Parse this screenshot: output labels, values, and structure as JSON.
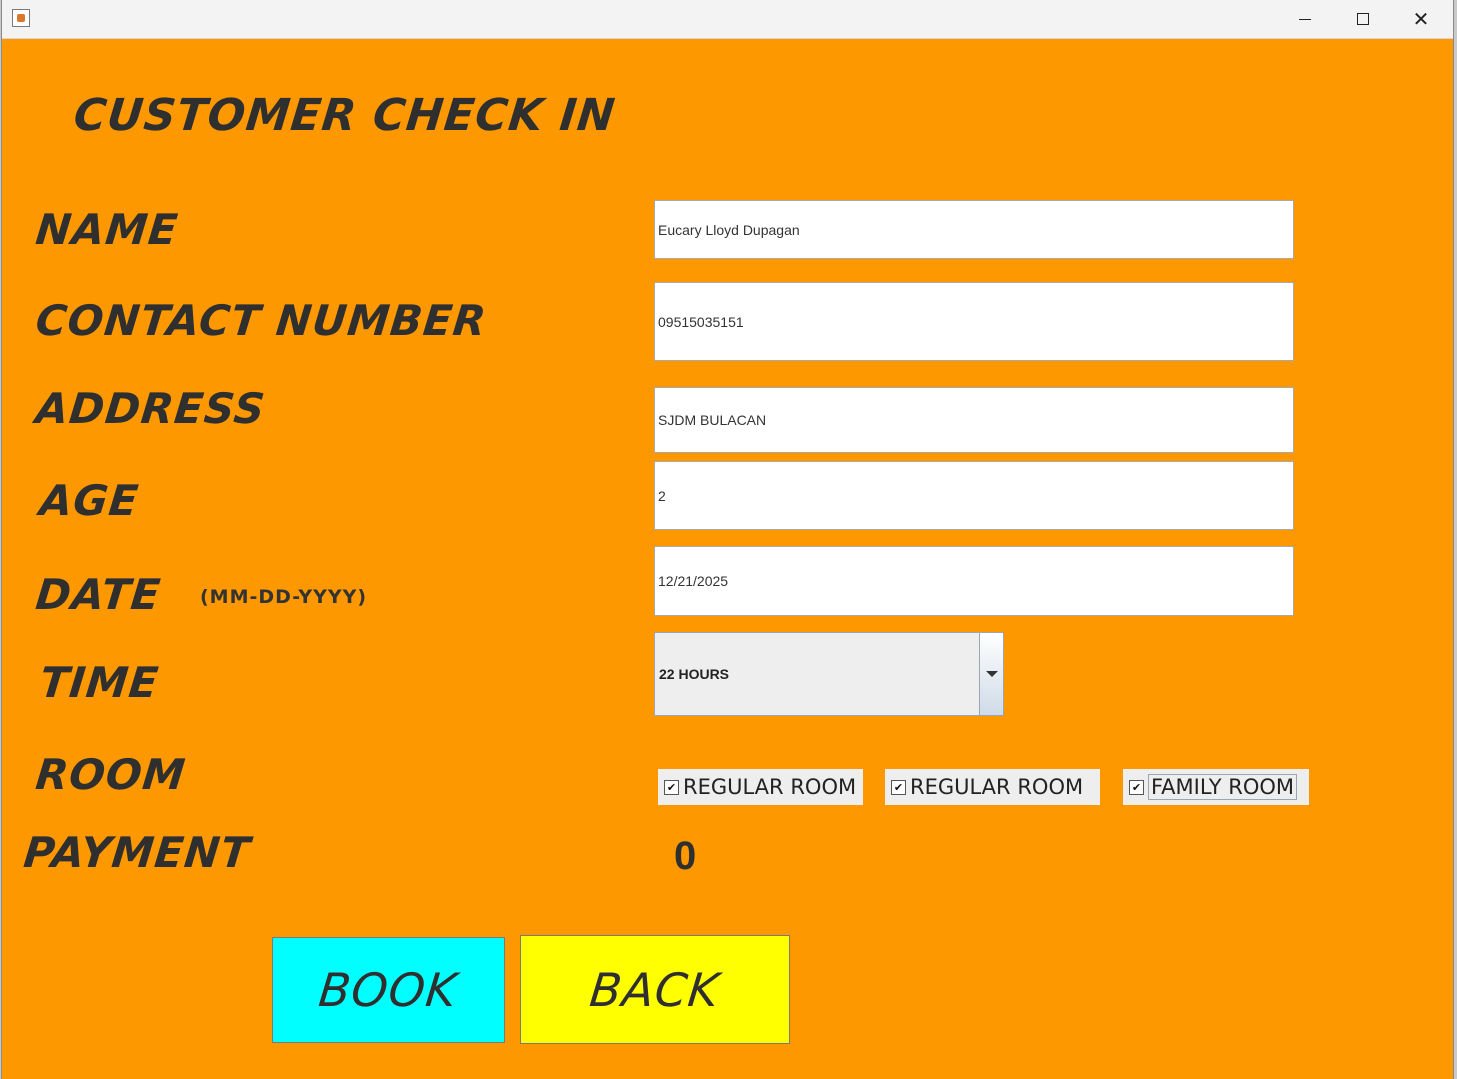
{
  "window": {
    "controls": {
      "minimize": "minimize",
      "maximize": "maximize",
      "close": "✕"
    }
  },
  "form": {
    "title": "CUSTOMER CHECK IN",
    "labels": {
      "name": "NAME",
      "contact": "CONTACT NUMBER",
      "address": "ADDRESS",
      "age": "AGE",
      "date": "DATE",
      "date_hint": "(MM-DD-YYYY)",
      "time": "TIME",
      "room": "ROOM",
      "payment": "PAYMENT"
    },
    "values": {
      "name": "Eucary Lloyd Dupagan",
      "contact": "09515035151",
      "address": "SJDM BULACAN",
      "age": "2",
      "date": "12/21/2025",
      "time": "22 HOURS",
      "payment": "0"
    },
    "rooms": [
      {
        "label": "REGULAR ROOM",
        "checked": true
      },
      {
        "label": "REGULAR ROOM",
        "checked": true
      },
      {
        "label": "FAMILY ROOM",
        "checked": true
      }
    ],
    "buttons": {
      "book": "BOOK",
      "back": "BACK"
    }
  },
  "colors": {
    "background": "#fd9801",
    "book_button": "#00ffff",
    "back_button": "#ffff00",
    "label_text": "#2f2f2f"
  },
  "icons": [
    "java-app-icon",
    "minimize-icon",
    "maximize-icon",
    "close-icon",
    "dropdown-arrow-icon",
    "checkbox-check-icon"
  ]
}
